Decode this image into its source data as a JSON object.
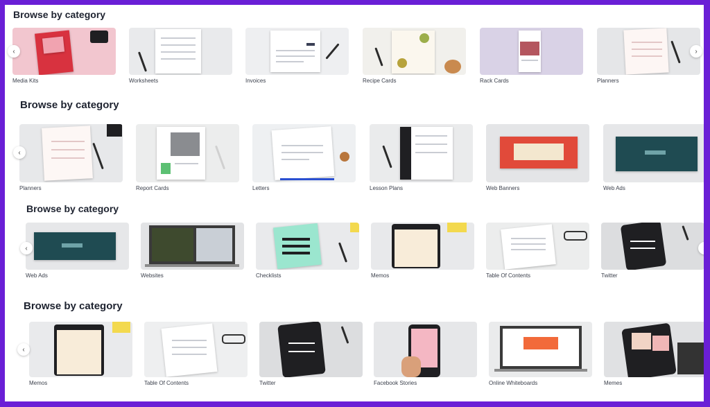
{
  "sections": [
    {
      "title": "Browse by category",
      "items": [
        "Media Kits",
        "Worksheets",
        "Invoices",
        "Recipe Cards",
        "Rack Cards",
        "Planners"
      ]
    },
    {
      "title": "Browse by category",
      "items": [
        "Planners",
        "Report Cards",
        "Letters",
        "Lesson Plans",
        "Web Banners",
        "Web Ads"
      ]
    },
    {
      "title": "Browse by category",
      "items": [
        "Web Ads",
        "Websites",
        "Checklists",
        "Memos",
        "Table Of Contents",
        "Twitter"
      ]
    },
    {
      "title": "Browse by category",
      "items": [
        "Memos",
        "Table Of Contents",
        "Twitter",
        "Facebook Stories",
        "Online Whiteboards",
        "Memes"
      ]
    }
  ],
  "nav": {
    "prev_symbol": "‹",
    "next_symbol": "›"
  },
  "colors": {
    "frame": "#6a1fd6",
    "card_bg": "#ececec"
  }
}
